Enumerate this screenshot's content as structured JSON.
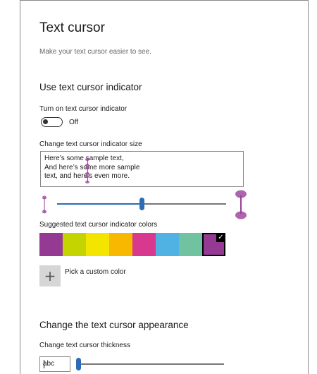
{
  "page": {
    "title": "Text cursor",
    "subtitle": "Make your text cursor easier to see."
  },
  "indicator": {
    "section_title": "Use text cursor indicator",
    "toggle_label": "Turn on text cursor indicator",
    "toggle_state": "Off",
    "toggle_on": false,
    "size_label": "Change text cursor indicator size",
    "sample_lines": [
      "Here’s some sample text,",
      "And here’s some more sample",
      "text, and here’s even more."
    ],
    "size_slider_value": 0.5,
    "colors_label": "Suggested text cursor indicator colors",
    "colors": [
      "#953a92",
      "#c4d400",
      "#f4e500",
      "#f9b800",
      "#d8388d",
      "#4fb2e3",
      "#70c2a1",
      "#953a92"
    ],
    "selected_color_index": 7,
    "check_glyph": "✓",
    "custom_color_label": "Pick a custom color",
    "plus_glyph": "+",
    "indicator_color": "#9b3f98",
    "accent_color": "#2b6cb5"
  },
  "appearance": {
    "section_title": "Change the text cursor appearance",
    "thickness_label": "Change text cursor thickness",
    "preview_text": "abc",
    "thickness_slider_value": 0.0
  }
}
